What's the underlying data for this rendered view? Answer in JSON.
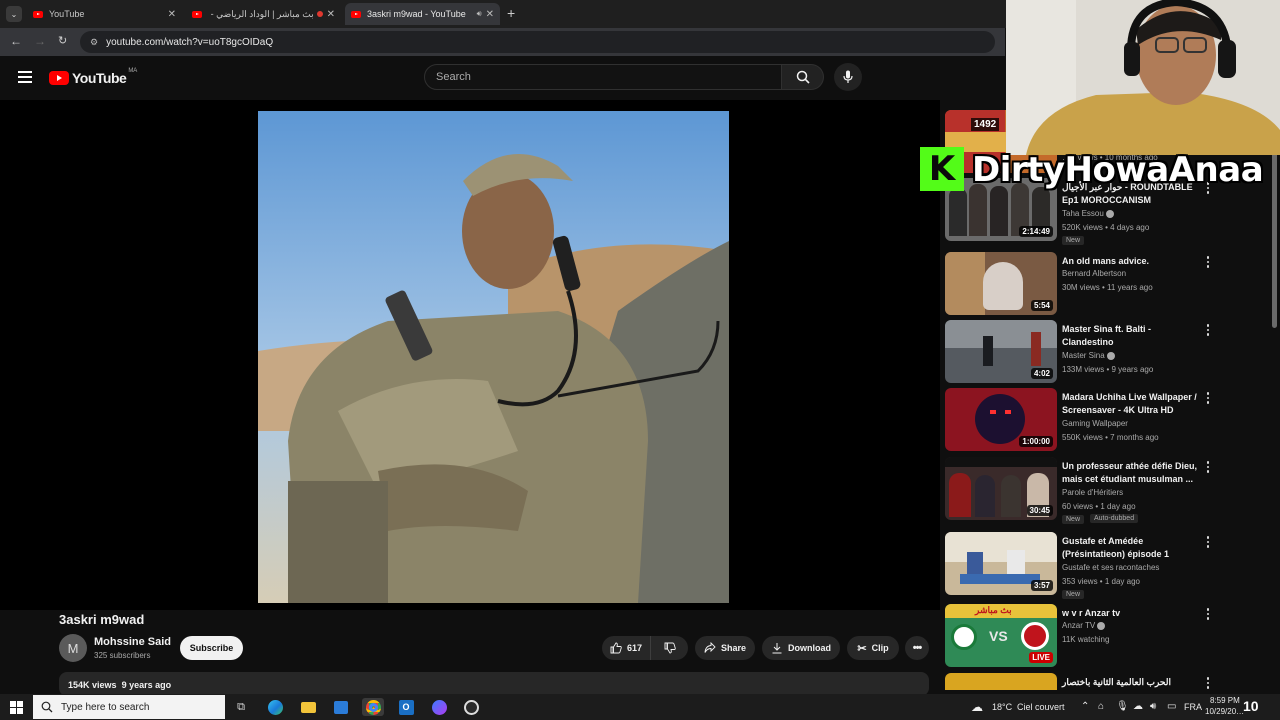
{
  "browser": {
    "tabs": [
      {
        "title": "YouTube",
        "active": false
      },
      {
        "title": "بث مباشر | الوداد الرياضي - ال",
        "active": false
      },
      {
        "title": "3askri m9wad - YouTube",
        "active": true
      }
    ],
    "url": "youtube.com/watch?v=uoT8gcOIDaQ"
  },
  "youtube": {
    "logo_text": "YouTube",
    "country_code": "MA",
    "search_placeholder": "Search"
  },
  "video": {
    "title": "3askri m9wad",
    "channel": {
      "avatar_letter": "M",
      "name": "Mohssine Said",
      "subscribers": "325 subscribers"
    },
    "subscribe_label": "Subscribe",
    "likes": "617",
    "share_label": "Share",
    "download_label": "Download",
    "clip_label": "Clip",
    "views": "154K views",
    "age": "9 years ago"
  },
  "recommendations": [
    {
      "title": "",
      "channel": "",
      "meta": "…K views • 10 months ago",
      "duration": "",
      "overlay_badge": "1492",
      "thumb_color": "#c46a2a"
    },
    {
      "title": "حوار عبر الأجيال - ROUNDTABLE Ep1 MOROCCANISM",
      "channel": "Taha Essou",
      "verified": true,
      "meta": "520K views • 4 days ago",
      "badge": "New",
      "duration": "2:14:49",
      "thumb_color": "#6b6b6b"
    },
    {
      "title": "An old mans advice.",
      "channel": "Bernard Albertson",
      "meta": "30M views • 11 years ago",
      "duration": "5:54",
      "thumb_color": "#7a5a43"
    },
    {
      "title": "Master Sina ft. Balti - Clandestino",
      "channel": "Master Sina",
      "verified": true,
      "meta": "133M views • 9 years ago",
      "duration": "4:02",
      "thumb_color": "#555a60"
    },
    {
      "title": "Madara Uchiha Live Wallpaper / Screensaver - 4K Ultra HD",
      "channel": "Gaming Wallpaper",
      "meta": "550K views • 7 months ago",
      "duration": "1:00:00",
      "thumb_color": "#8c1420"
    },
    {
      "title": "Un professeur athée défie Dieu, mais cet étudiant musulman ...",
      "channel": "Parole d'Héritiers",
      "meta": "60 views • 1 day ago",
      "badge": "New",
      "badge2": "Auto-dubbed",
      "duration": "30:45",
      "thumb_color": "#3a2a2a"
    },
    {
      "title": "Gustafe et Amédée (Présintatieon) épisode 1",
      "channel": "Gustafe et ses racontaches",
      "meta": "353 views • 1 day ago",
      "badge": "New",
      "duration": "3:57",
      "thumb_color": "#c9b89a"
    },
    {
      "title": "w v r Anzar tv",
      "channel": "Anzar TV",
      "verified": true,
      "meta": "11K watching",
      "duration": "LIVE",
      "thumb_color": "#2f8a56",
      "thumb_banner": "بث مباشر",
      "thumb_vs": "VS"
    },
    {
      "title": "الحرب العالمية الثانية باختصار",
      "channel": "",
      "meta": "",
      "duration": "",
      "thumb_color": "#d9a520"
    }
  ],
  "stream_overlay": {
    "kick_letter": "K",
    "streamer_name": "DirtyHowaAnaa"
  },
  "taskbar": {
    "search_placeholder": "Type here to search",
    "temperature": "18°C",
    "weather": "Ciel couvert",
    "language": "FRA",
    "time": "8:59 PM",
    "date": "10/29/20…",
    "notification_count": "10"
  },
  "colors": {
    "background": "#0f0f0f",
    "youtube_red": "#ff0000",
    "kick_green": "#53fc18",
    "pill_bg": "#272727"
  }
}
